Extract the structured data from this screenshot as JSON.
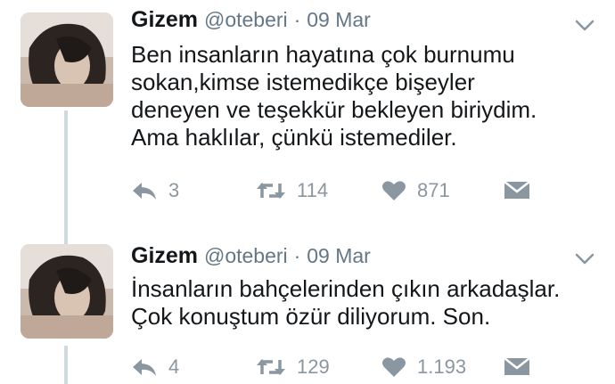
{
  "tweets": [
    {
      "name": "Gizem",
      "handle": "@oteberi",
      "separator": "·",
      "date": "09 Mar",
      "text_lines": [
        "Ben insanların hayatına çok burnumu",
        "sokan,kimse istemedikçe bişeyler",
        "deneyen ve teşekkür bekleyen biriydim.",
        "Ama haklılar, çünkü istemediler."
      ],
      "replies": "3",
      "retweets": "114",
      "likes": "871"
    },
    {
      "name": "Gizem",
      "handle": "@oteberi",
      "separator": "·",
      "date": "09 Mar",
      "text_lines": [
        "İnsanların bahçelerinden çıkın arkadaşlar.",
        "Çok konuştum özür diliyorum. Son."
      ],
      "replies": "4",
      "retweets": "129",
      "likes": "1.193"
    }
  ],
  "colors": {
    "text": "#14171a",
    "secondary": "#657786",
    "icon": "#8a96a0",
    "thread_line": "#cfd9de"
  },
  "icons": [
    "reply-icon",
    "retweet-icon",
    "like-icon",
    "message-icon",
    "chevron-down-icon"
  ]
}
